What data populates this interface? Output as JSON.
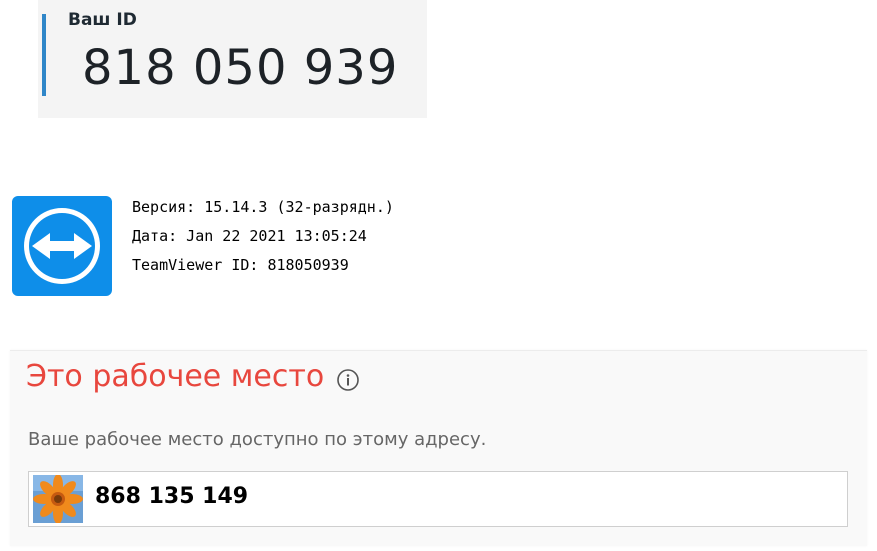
{
  "your_id": {
    "label": "Ваш ID",
    "value": "818 050 939"
  },
  "about": {
    "version": "Версия: 15.14.3 (32-разрядн.)",
    "date": "Дата: Jan 22 2021 13:05:24",
    "teamviewer_id": "TeamViewer ID: 818050939",
    "logo_icon": "teamviewer-logo-icon"
  },
  "workplace": {
    "title": "Это рабочее место",
    "info_icon": "info-icon",
    "description": "Ваше рабочее место доступно по этому адресу.",
    "address": "868 135 149",
    "avatar_icon": "flower-avatar"
  },
  "colors": {
    "accent_blue": "#2f86c8",
    "logo_blue": "#0e8ee9",
    "title_red": "#e8473e"
  }
}
